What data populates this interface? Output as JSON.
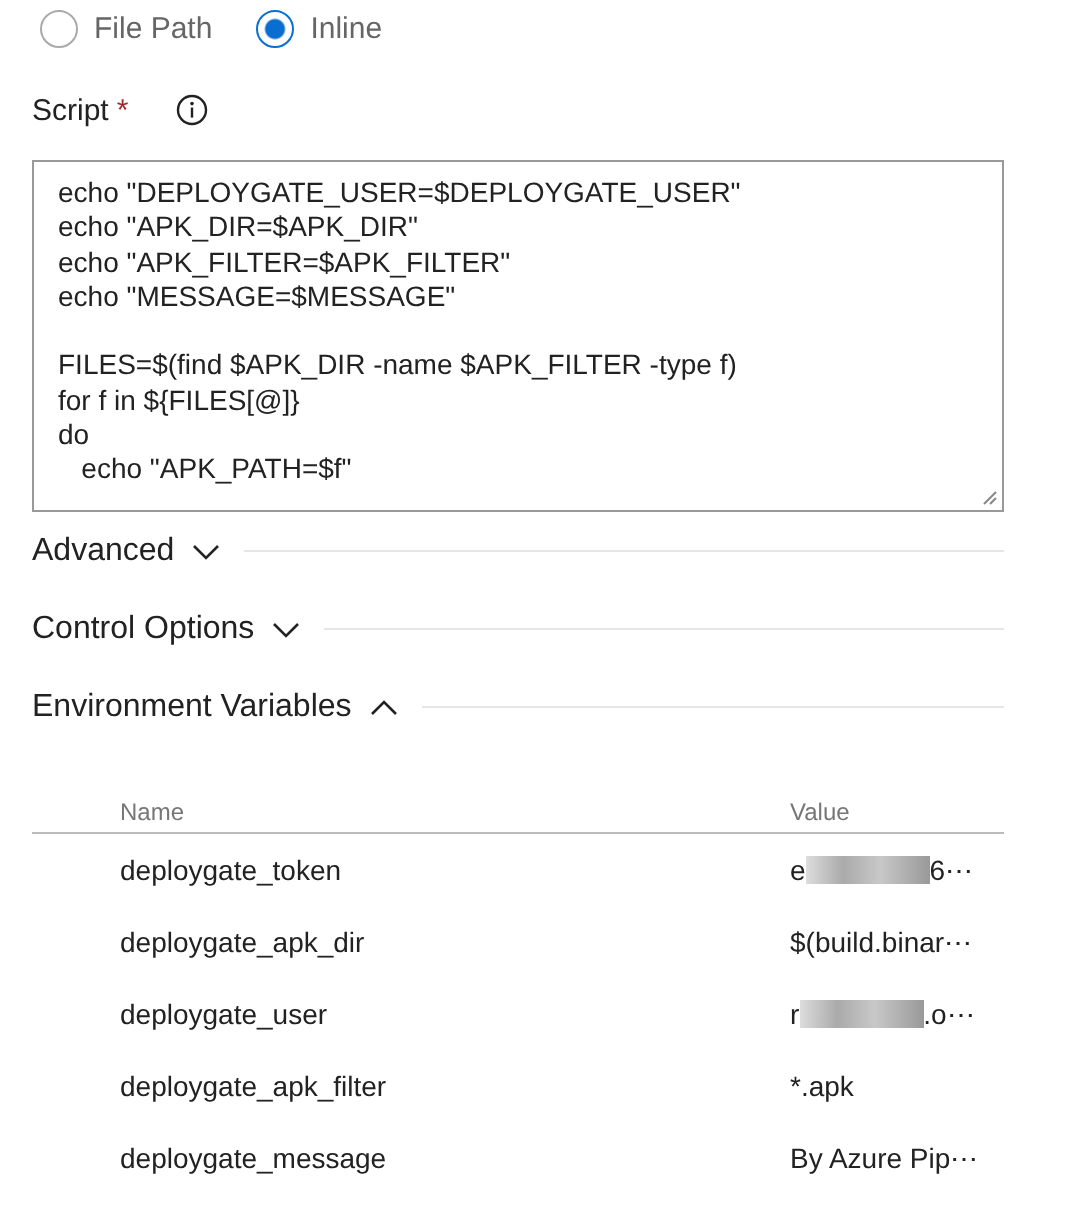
{
  "source_options": [
    {
      "label": "File Path",
      "selected": false
    },
    {
      "label": "Inline",
      "selected": true
    }
  ],
  "script": {
    "label": "Script",
    "required_mark": "*",
    "value": "echo \"DEPLOYGATE_USER=$DEPLOYGATE_USER\"\necho \"APK_DIR=$APK_DIR\"\necho \"APK_FILTER=$APK_FILTER\"\necho \"MESSAGE=$MESSAGE\"\n\nFILES=$(find $APK_DIR -name $APK_FILTER -type f)\nfor f in ${FILES[@]}\ndo\n   echo \"APK_PATH=$f\""
  },
  "sections": [
    {
      "title": "Advanced",
      "expanded": false
    },
    {
      "title": "Control Options",
      "expanded": false
    },
    {
      "title": "Environment Variables",
      "expanded": true
    }
  ],
  "table": {
    "columns": [
      "Name",
      "Value"
    ],
    "rows": [
      {
        "name": "deploygate_token",
        "value": "e",
        "value_end": "6⋯",
        "redacted": true
      },
      {
        "name": "deploygate_apk_dir",
        "value": "$(build.binar⋯",
        "redacted": false
      },
      {
        "name": "deploygate_user",
        "value": "r",
        "value_end": ".o⋯",
        "redacted": true
      },
      {
        "name": "deploygate_apk_filter",
        "value": "*.apk",
        "redacted": false
      },
      {
        "name": "deploygate_message",
        "value": "By Azure Pip⋯",
        "redacted": false
      }
    ]
  }
}
